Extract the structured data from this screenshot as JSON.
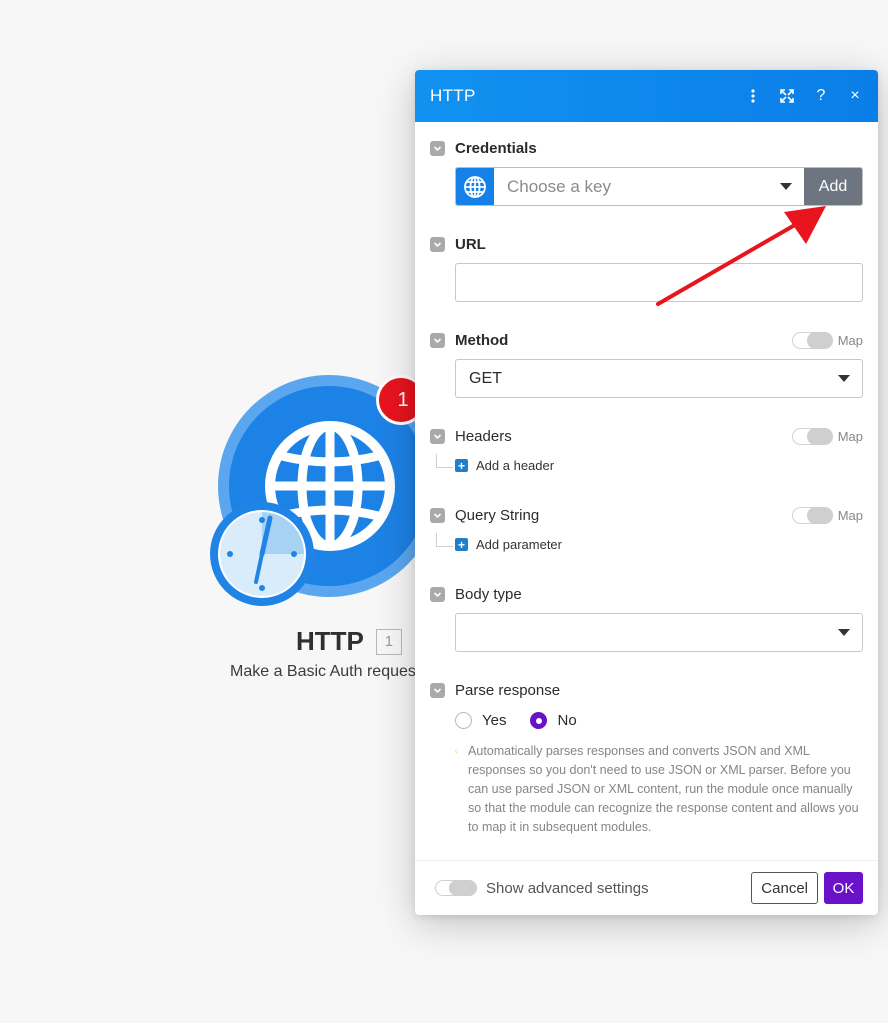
{
  "module": {
    "badge_count": "1",
    "name": "HTTP",
    "number": "1",
    "description": "Make a Basic Auth request"
  },
  "dialog": {
    "title": "HTTP",
    "icons": [
      "more-vertical-icon",
      "expand-icon",
      "help-icon",
      "close-icon"
    ],
    "help_label": "?",
    "close_label": "×"
  },
  "fields": {
    "credentials": {
      "label": "Credentials",
      "placeholder": "Choose a key",
      "add_label": "Add"
    },
    "url": {
      "label": "URL",
      "value": ""
    },
    "method": {
      "label": "Method",
      "map_label": "Map",
      "value": "GET"
    },
    "headers": {
      "label": "Headers",
      "map_label": "Map",
      "add_label": "Add a header"
    },
    "query_string": {
      "label": "Query String",
      "map_label": "Map",
      "add_label": "Add parameter"
    },
    "body_type": {
      "label": "Body type",
      "value": ""
    },
    "parse_response": {
      "label": "Parse response",
      "options": [
        {
          "label": "Yes",
          "selected": false
        },
        {
          "label": "No",
          "selected": true
        }
      ],
      "hint": "Automatically parses responses and converts JSON and XML responses so you don't need to use JSON or XML parser. Before you can use parsed JSON or XML content, run the module once manually so that the module can recognize the response content and allows you to map it in subsequent modules."
    }
  },
  "footer": {
    "advanced_label": "Show advanced settings",
    "cancel_label": "Cancel",
    "ok_label": "OK"
  },
  "colors": {
    "header_blue": "#0a7ee8",
    "accent_purple": "#6a12c8",
    "badge_red": "#e8141e",
    "arrow_red": "#e8141e"
  }
}
